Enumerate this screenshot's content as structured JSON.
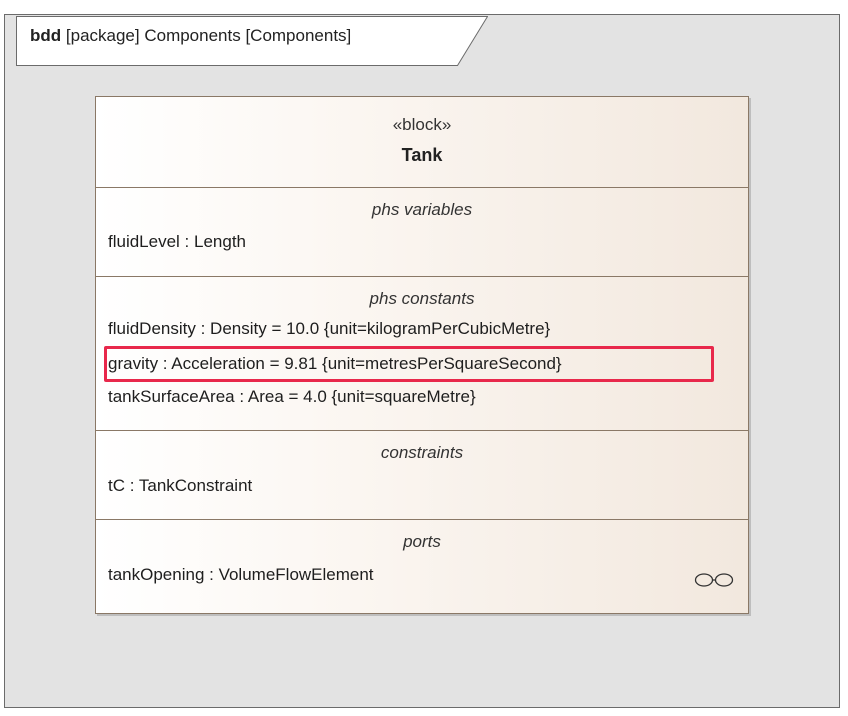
{
  "frame": {
    "kind": "bdd",
    "header": "[package] Components [Components]"
  },
  "block": {
    "stereotype": "«block»",
    "name": "Tank",
    "compartments": {
      "variables": {
        "title": "phs variables",
        "items": [
          "fluidLevel : Length"
        ]
      },
      "constants": {
        "title": "phs constants",
        "items": [
          "fluidDensity : Density = 10.0 {unit=kilogramPerCubicMetre}",
          "gravity : Acceleration = 9.81 {unit=metresPerSquareSecond}",
          "tankSurfaceArea : Area = 4.0 {unit=squareMetre}"
        ]
      },
      "constraints": {
        "title": "constraints",
        "items": [
          "tC : TankConstraint"
        ]
      },
      "ports": {
        "title": "ports",
        "items": [
          "tankOpening : VolumeFlowElement"
        ]
      }
    },
    "port_icon": "proxy-port-icon"
  },
  "colors": {
    "highlight": "#e8284b",
    "block_border": "#8a7866",
    "frame_background": "#e3e3e3"
  }
}
